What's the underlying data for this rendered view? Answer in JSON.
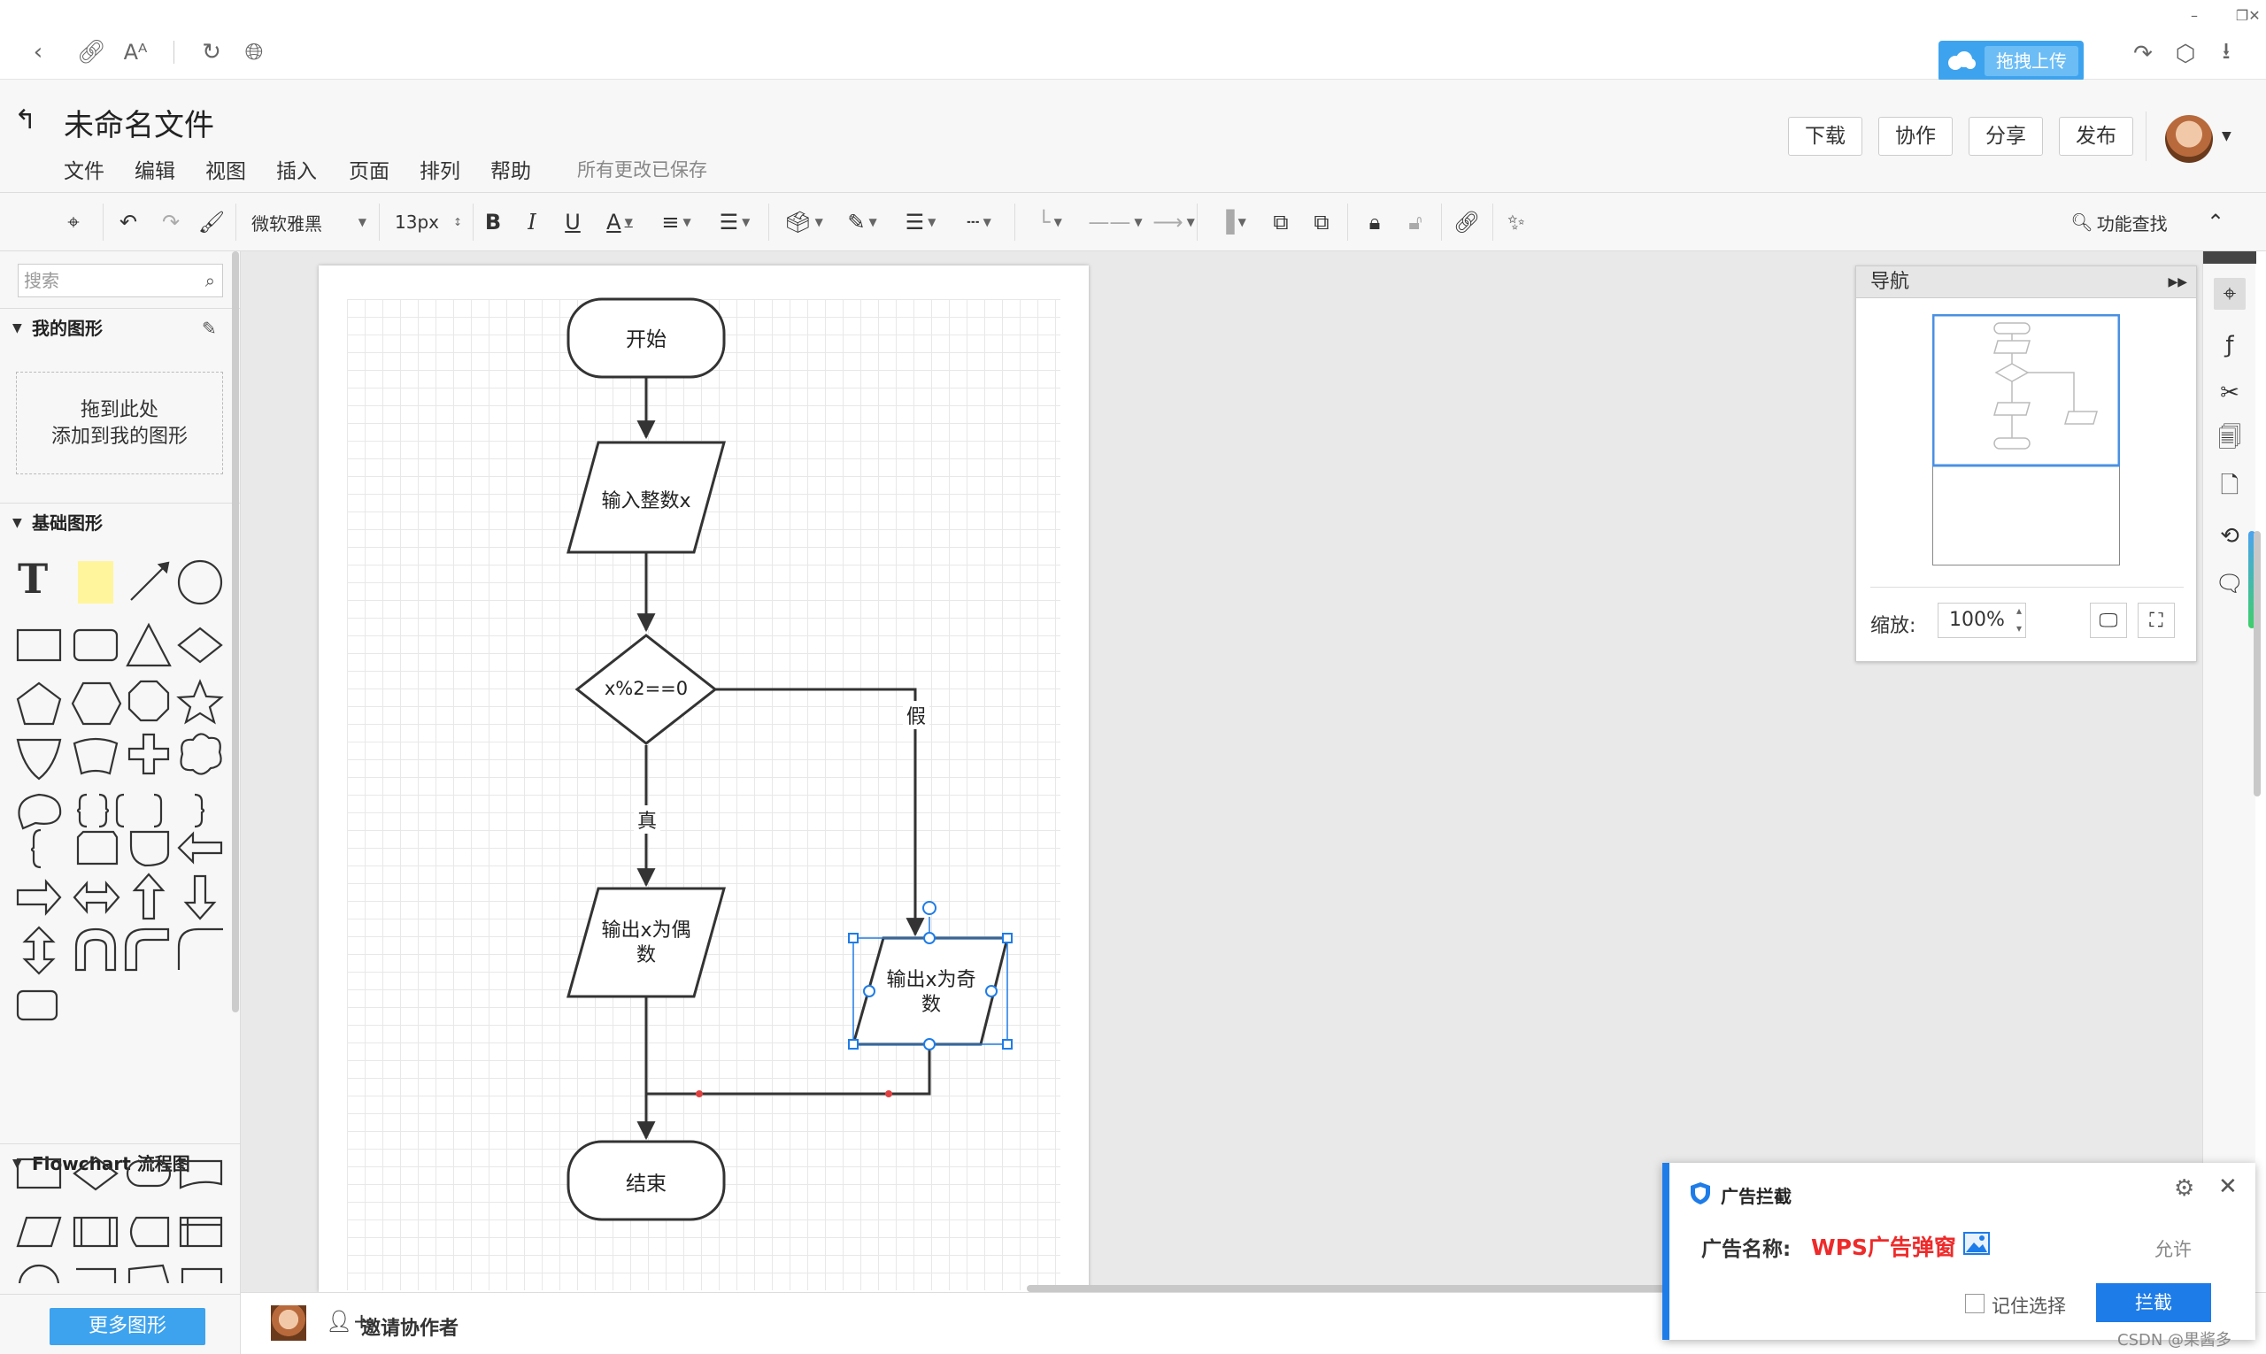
{
  "browser": {
    "upload_label": "拖拽上传"
  },
  "app": {
    "doc_title": "未命名文件",
    "menus": [
      "文件",
      "编辑",
      "视图",
      "插入",
      "页面",
      "排列",
      "帮助"
    ],
    "save_status": "所有更改已保存",
    "buttons": {
      "download": "下载",
      "collab": "协作",
      "share": "分享",
      "publish": "发布"
    }
  },
  "toolbar": {
    "font_family": "微软雅黑",
    "font_size": "13px",
    "bold": "B",
    "italic": "I",
    "underline": "U",
    "font_color": "A",
    "search_feature": "功能查找"
  },
  "sidebar": {
    "search_placeholder": "搜索",
    "my_shapes_title": "我的图形",
    "drop_line1": "拖到此处",
    "drop_line2": "添加到我的图形",
    "basic_shapes_title": "基础图形",
    "flowchart_title": "Flowchart 流程图",
    "more_shapes": "更多图形"
  },
  "flowchart": {
    "start": "开始",
    "input": "输入整数x",
    "decision": "x%2==0",
    "true_label": "真",
    "false_label": "假",
    "even_line1": "输出x为偶",
    "even_line2": "数",
    "odd_line1": "输出x为奇",
    "odd_line2": "数",
    "end": "结束"
  },
  "navigator": {
    "title": "导航",
    "zoom_label": "缩放:",
    "zoom_value": "100%"
  },
  "bottom": {
    "invite": "邀请协作者"
  },
  "adblock": {
    "title": "广告拦截",
    "name_label": "广告名称:",
    "name_value": "WPS广告弹窗",
    "allow": "允许",
    "remember": "记住选择",
    "block": "拦截",
    "watermark": "CSDN @果酱多"
  },
  "colors": {
    "accent": "#3ea3ee",
    "selection": "#1e7ce8",
    "ad_red": "#ee2a2a"
  }
}
